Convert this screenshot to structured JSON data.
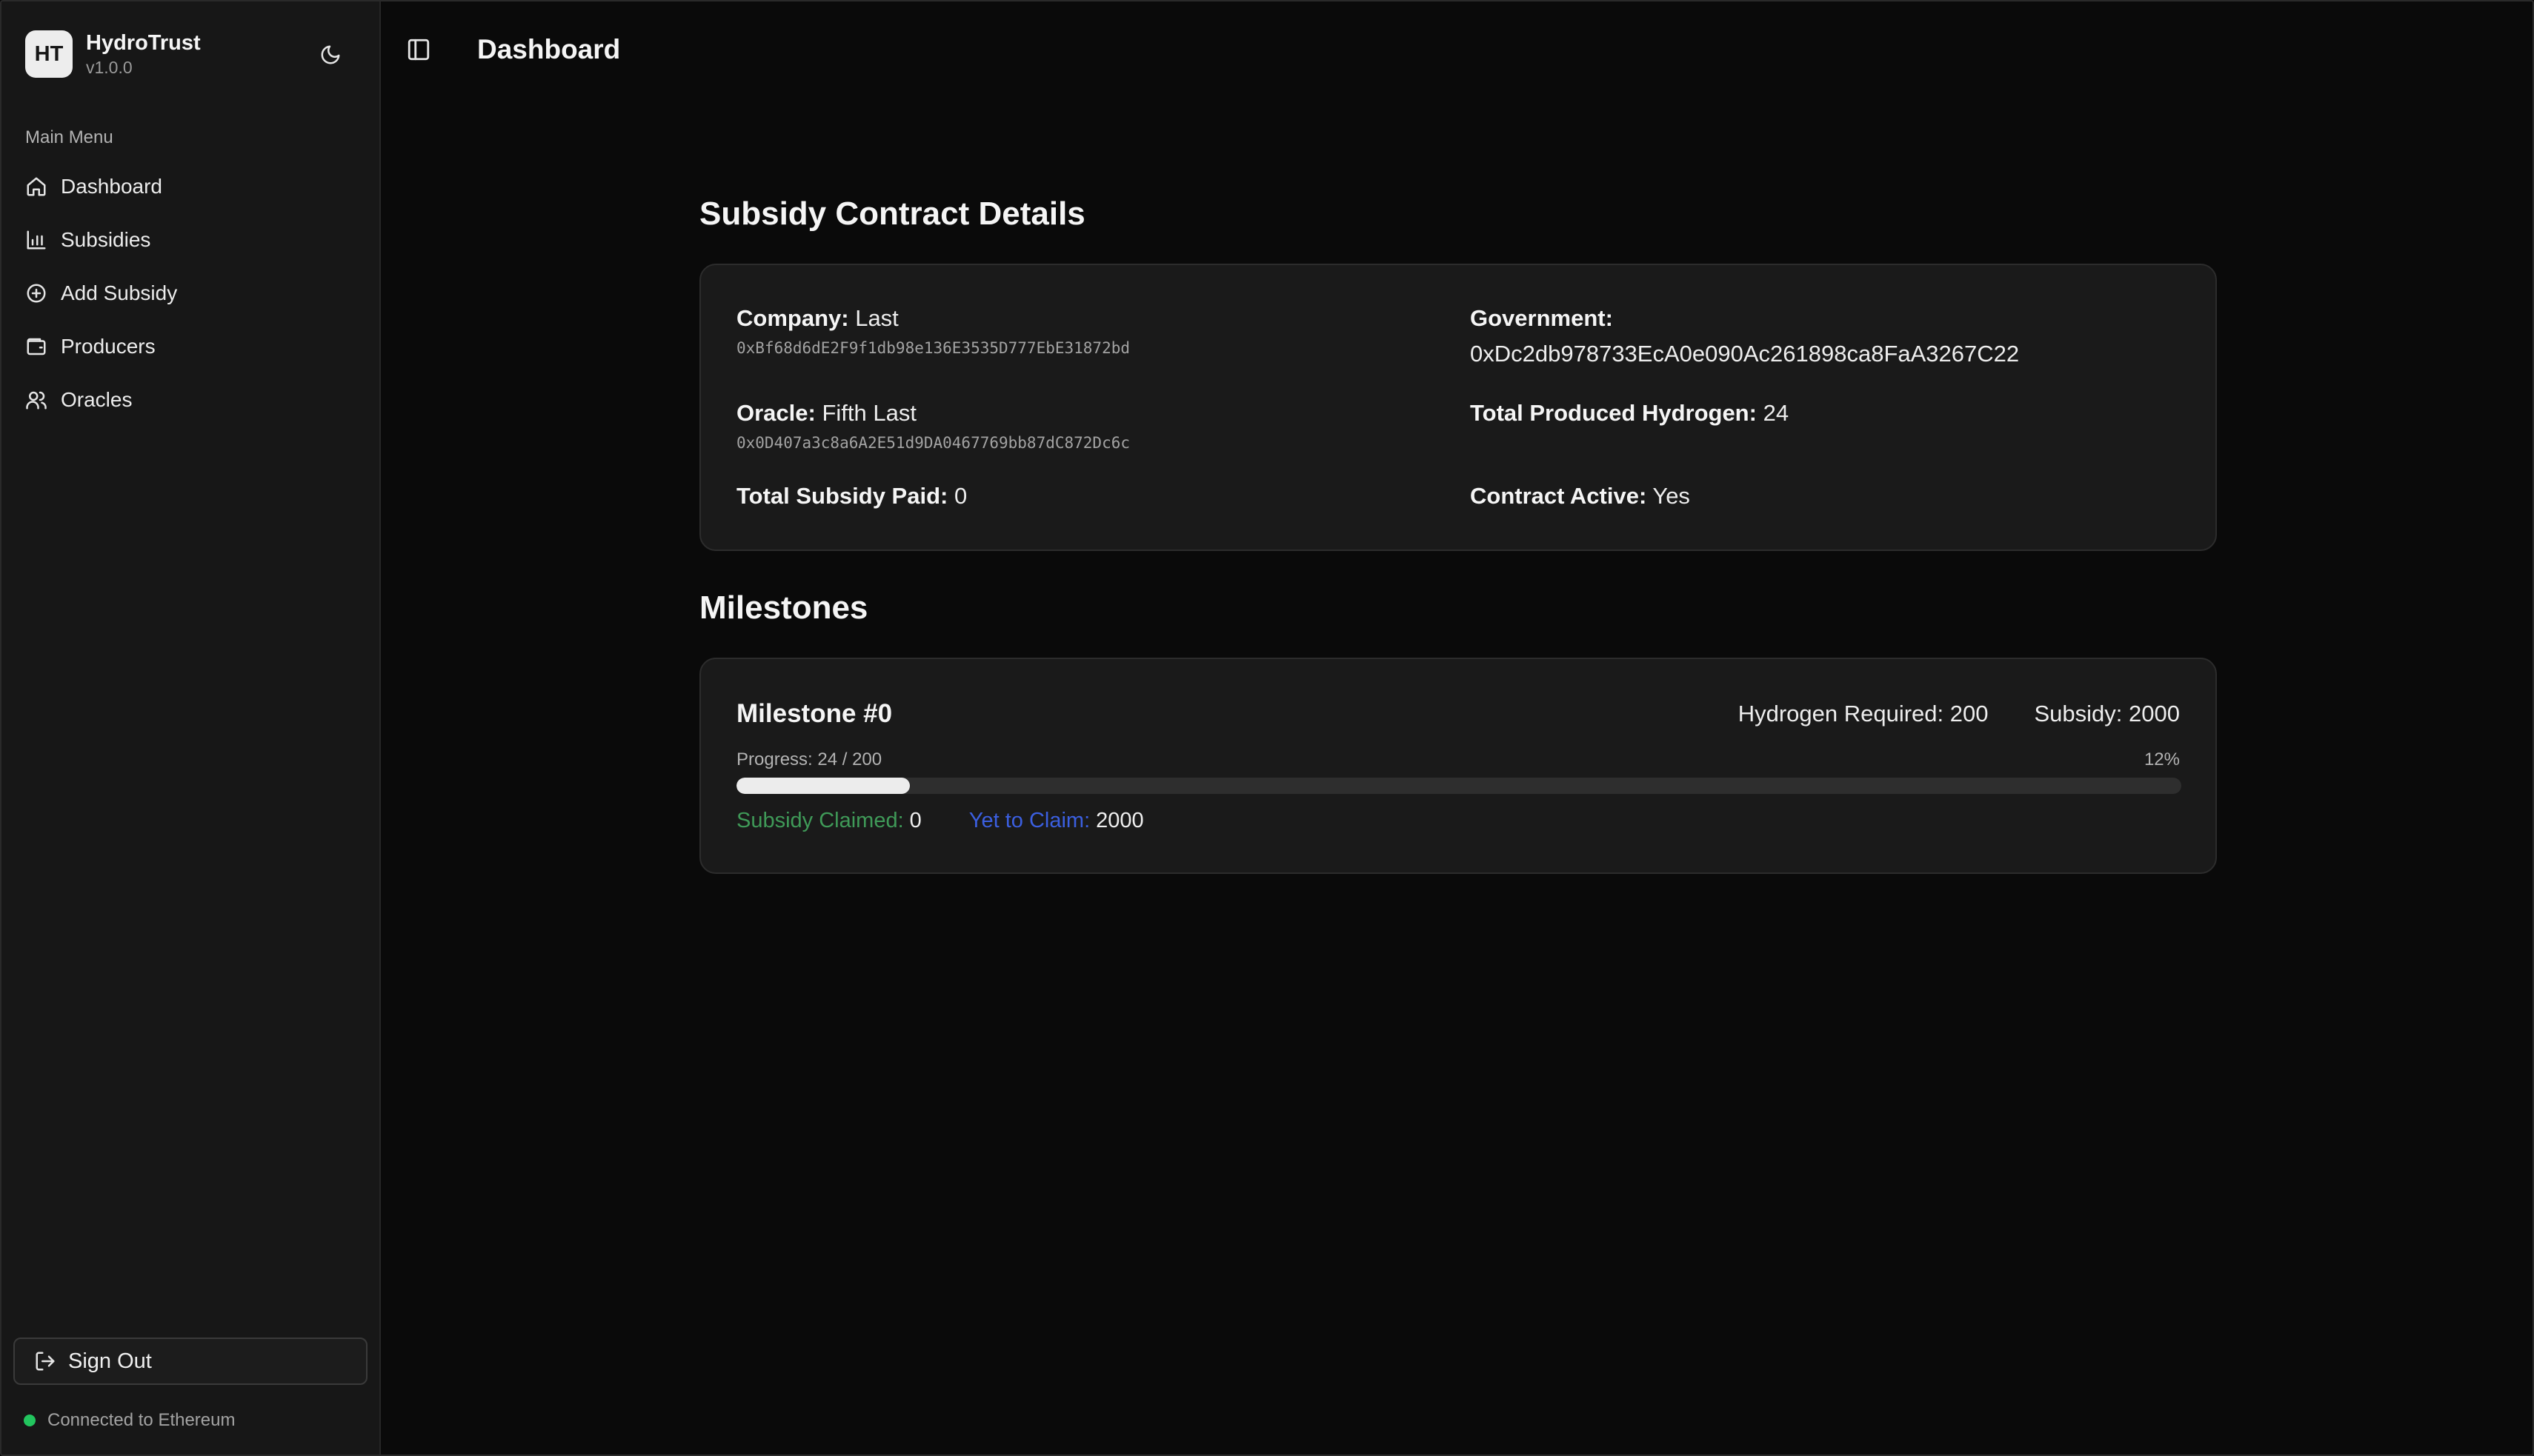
{
  "app": {
    "initials": "HT",
    "name": "HydroTrust",
    "version": "v1.0.0"
  },
  "sidebar": {
    "menu_label": "Main Menu",
    "items": [
      {
        "label": "Dashboard",
        "icon": "home-icon"
      },
      {
        "label": "Subsidies",
        "icon": "bar-chart-icon"
      },
      {
        "label": "Add Subsidy",
        "icon": "plus-circle-icon"
      },
      {
        "label": "Producers",
        "icon": "wallet-icon"
      },
      {
        "label": "Oracles",
        "icon": "users-icon"
      }
    ],
    "sign_out_label": "Sign Out",
    "connection_status": "Connected to Ethereum"
  },
  "header": {
    "title": "Dashboard"
  },
  "contract": {
    "section_title": "Subsidy Contract Details",
    "company_label": "Company:",
    "company_name": "Last",
    "company_address": "0xBf68d6dE2F9f1db98e136E3535D777EbE31872bd",
    "government_label": "Government:",
    "government_address": "0xDc2db978733EcA0e090Ac261898ca8FaA3267C22",
    "oracle_label": "Oracle:",
    "oracle_name": "Fifth Last",
    "oracle_address": "0x0D407a3c8a6A2E51d9DA0467769bb87dC872Dc6c",
    "total_produced_label": "Total Produced Hydrogen:",
    "total_produced_value": "24",
    "total_paid_label": "Total Subsidy Paid:",
    "total_paid_value": "0",
    "active_label": "Contract Active:",
    "active_value": "Yes"
  },
  "milestones": {
    "section_title": "Milestones",
    "items": [
      {
        "title": "Milestone #0",
        "hydrogen_required_label": "Hydrogen Required:",
        "hydrogen_required_value": "200",
        "subsidy_label": "Subsidy:",
        "subsidy_value": "2000",
        "progress_label": "Progress: 24 / 200",
        "progress_percent_label": "12%",
        "progress_fraction": 0.12,
        "claimed_label": "Subsidy Claimed:",
        "claimed_value": "0",
        "yet_label": "Yet to Claim:",
        "yet_value": "2000"
      }
    ]
  },
  "colors": {
    "status_connected": "#22c55e",
    "claimed": "#3f9a58",
    "yet_to_claim": "#3b5fe0"
  }
}
